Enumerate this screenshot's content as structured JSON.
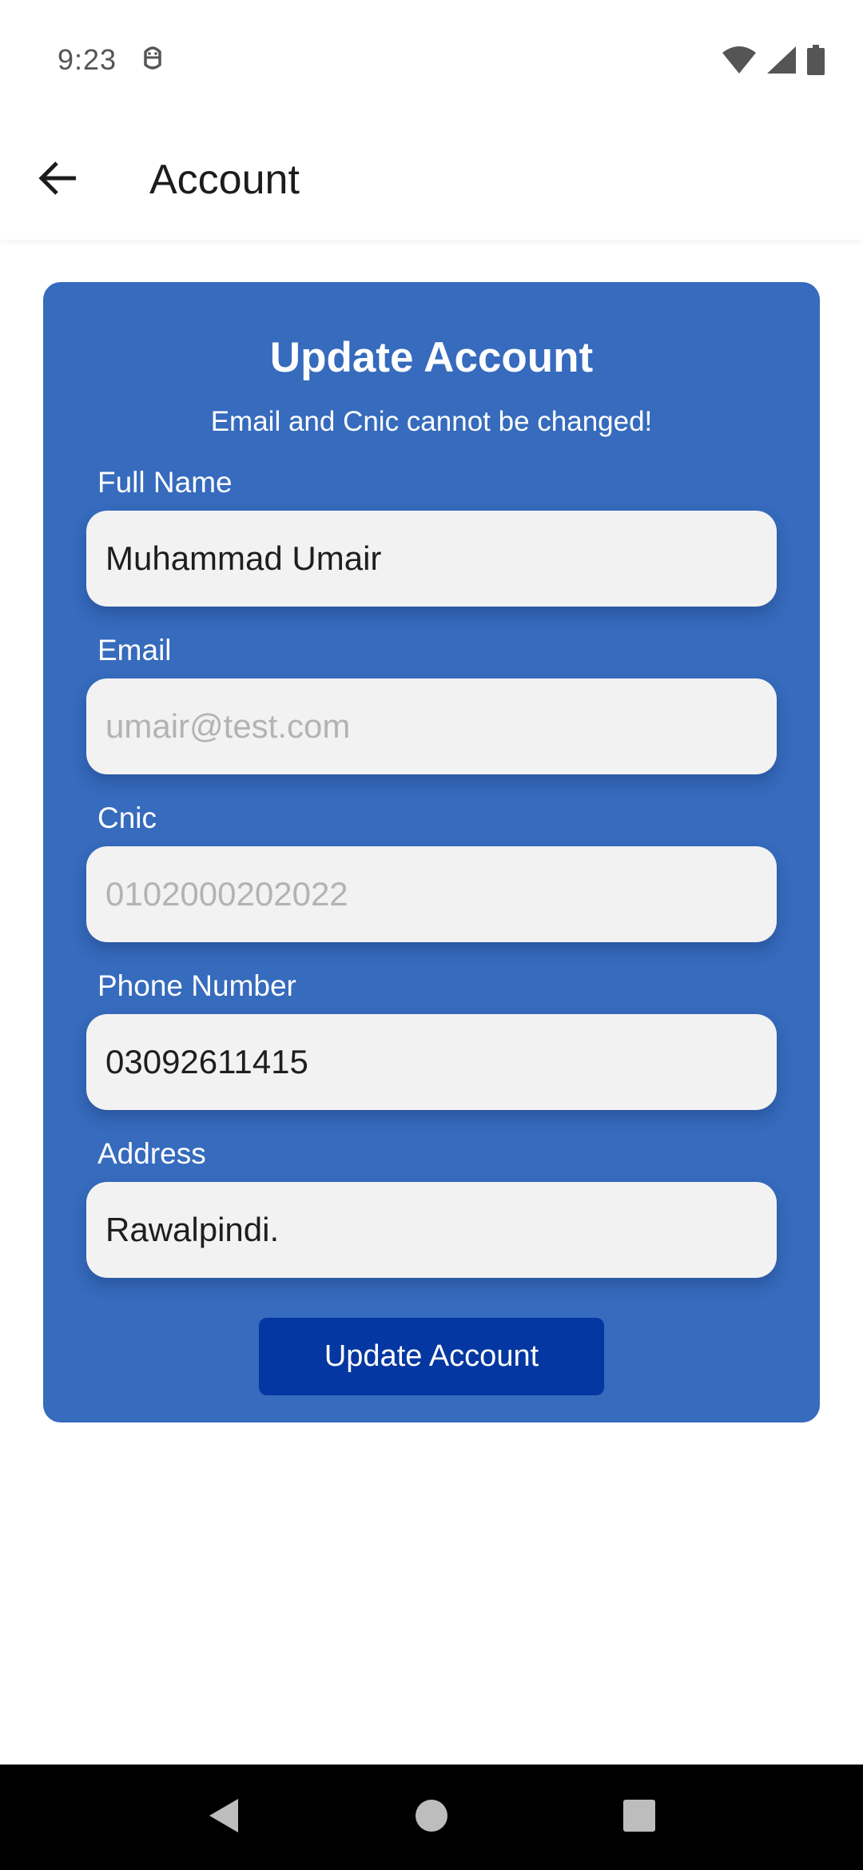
{
  "status_bar": {
    "time": "9:23",
    "icons": [
      "android-debug-icon",
      "wifi-icon",
      "cell-signal-icon",
      "battery-icon"
    ]
  },
  "app_bar": {
    "back_icon": "arrow-back-icon",
    "title": "Account"
  },
  "card": {
    "title": "Update Account",
    "subtitle": "Email and Cnic cannot be changed!",
    "background": "#366bbd",
    "fields": [
      {
        "label": "Full Name",
        "value": "Muhammad Umair",
        "editable": true
      },
      {
        "label": "Email",
        "placeholder": "umair@test.com",
        "editable": false
      },
      {
        "label": "Cnic",
        "placeholder": "0102000202022",
        "editable": false
      },
      {
        "label": "Phone Number",
        "value": "03092611415",
        "editable": true
      },
      {
        "label": "Address",
        "value": "Rawalpindi.",
        "editable": true
      }
    ],
    "submit_label": "Update Account",
    "submit_color": "#0437a1"
  },
  "nav_bar": {
    "icons": [
      "nav-back-icon",
      "nav-home-icon",
      "nav-recents-icon"
    ]
  }
}
